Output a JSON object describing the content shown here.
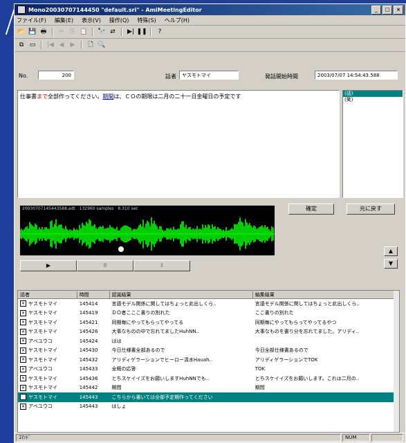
{
  "window": {
    "title": "Mono20030707144450 \"default.sri\" - AmiMeetingEditor",
    "buttons": [
      "_",
      "□",
      "×"
    ]
  },
  "menu": [
    "ファイル(F)",
    "編集(E)",
    "表示(V)",
    "操作(Q)",
    "特殊(S)",
    "ヘルプ(H)"
  ],
  "toolbar1": [
    {
      "icon": "open-folder-icon",
      "glyph": "📂",
      "enabled": true
    },
    {
      "icon": "save-icon",
      "glyph": "💾",
      "enabled": true
    },
    {
      "icon": "print-icon",
      "glyph": "🖶",
      "enabled": true
    },
    {
      "icon": "cut-icon",
      "glyph": "✂",
      "enabled": false
    },
    {
      "icon": "copy-icon",
      "glyph": "⎘",
      "enabled": false
    },
    {
      "icon": "paste-icon",
      "glyph": "📋",
      "enabled": false
    },
    {
      "icon": "find-icon",
      "glyph": "🔭",
      "enabled": true
    },
    {
      "icon": "replace-icon",
      "glyph": "⇄",
      "enabled": true
    },
    {
      "icon": "play-next-icon",
      "glyph": "▶|",
      "enabled": true
    },
    {
      "icon": "pause-icon",
      "glyph": "❚❚",
      "enabled": true
    },
    {
      "icon": "help-icon",
      "glyph": "?",
      "enabled": true
    }
  ],
  "toolbar2": [
    {
      "icon": "page-copy-icon",
      "glyph": "⧉",
      "enabled": true
    },
    {
      "icon": "page-icon",
      "glyph": "▭",
      "enabled": true
    },
    {
      "icon": "back-start-icon",
      "glyph": "|◀",
      "enabled": false
    },
    {
      "icon": "back-icon",
      "glyph": "◀",
      "enabled": false
    },
    {
      "icon": "forward-icon",
      "glyph": "▶",
      "enabled": false
    },
    {
      "icon": "new-doc-icon",
      "glyph": "🗋",
      "enabled": true
    },
    {
      "icon": "search-icon",
      "glyph": "🔍",
      "enabled": true
    }
  ],
  "fields": {
    "no_label": "No.",
    "no_value": "200",
    "speaker_label": "話者",
    "speaker_value": "ヤスモトマイ",
    "time_label": "発話開始時間",
    "time_value": "2003/07/07 14:54:43.588"
  },
  "editor": {
    "part1": "仕事書",
    "part2_red": "まで",
    "part3": "全部作ってください。",
    "part4_blue": "期間",
    "part5": "は、ＣＯの期限は二月の二十一日金曜日の予定です"
  },
  "speaker_list": [
    {
      "label": "(話)",
      "selected": true
    },
    {
      "label": "(笑)",
      "selected": false
    }
  ],
  "wave_header": "20030707145443588.adt　132960 samples　8.310 sec",
  "buttons": {
    "confirm": "確定",
    "revert": "元に戻す",
    "up": "▲",
    "down": "▼",
    "play": "▶",
    "pause": "Ⅲ",
    "stop": "Ⅱ"
  },
  "table": {
    "headers": [
      "話者",
      "時間",
      "認識結果",
      "編集結果"
    ],
    "rows": [
      {
        "speaker": "ヤスモトマイ",
        "time": "145414",
        "recog": "言語モデル関係に関してはちょっと此出しくら..",
        "edit": "言語モデル関係に関してはちょっと此出しくら..",
        "selected": false
      },
      {
        "speaker": "ヤスモトマイ",
        "time": "145419",
        "recog": "ＤＯ者こここ書りの別れた",
        "edit": "ここ書りの別れた",
        "selected": false
      },
      {
        "speaker": "ヤスモトマイ",
        "time": "145421",
        "recog": "同期毎にやってもらってやってる",
        "edit": "同期毎にやってもらってやってるやつ",
        "selected": false
      },
      {
        "speaker": "ヤスモトマイ",
        "time": "145426",
        "recog": "大事なものの中で忘れてましたHuhNN..",
        "edit": "大事なものを書り分を忘れてました。アリディ..",
        "selected": false
      },
      {
        "speaker": "アベユウコ",
        "time": "145424",
        "recog": "はは",
        "edit": "",
        "selected": false
      },
      {
        "speaker": "ヤスモトマイ",
        "time": "145430",
        "recog": "今日仕様書全部あるので",
        "edit": "今日全部仕様書あるので",
        "selected": false
      },
      {
        "speaker": "ヤスモトマイ",
        "time": "145432",
        "recog": "アリディゲラーションでヒーロー清水Hauah..",
        "edit": "アリディゲラーションでTOK",
        "selected": false
      },
      {
        "speaker": "アベユウコ",
        "time": "145433",
        "recog": "全概の応答",
        "edit": "TOK",
        "selected": false
      },
      {
        "speaker": "ヤスモトマイ",
        "time": "145436",
        "recog": "とちスケイイズをお願いしますHuhNNでも..",
        "edit": "とちスケイイズをお願いします。これは二月の..",
        "selected": false
      },
      {
        "speaker": "ヤスモトマイ",
        "time": "145442",
        "recog": "期間",
        "edit": "期間",
        "selected": false
      },
      {
        "speaker": "ヤスモトマイ",
        "time": "145443",
        "recog": "こちらから書いては全部予定期作ってください",
        "edit": "",
        "selected": true
      },
      {
        "speaker": "アベユウコ",
        "time": "145443",
        "recog": "はしょ",
        "edit": "",
        "selected": false
      }
    ]
  },
  "status": {
    "left": "ｺﾏﾝﾄﾞ",
    "mid": "NUM"
  }
}
